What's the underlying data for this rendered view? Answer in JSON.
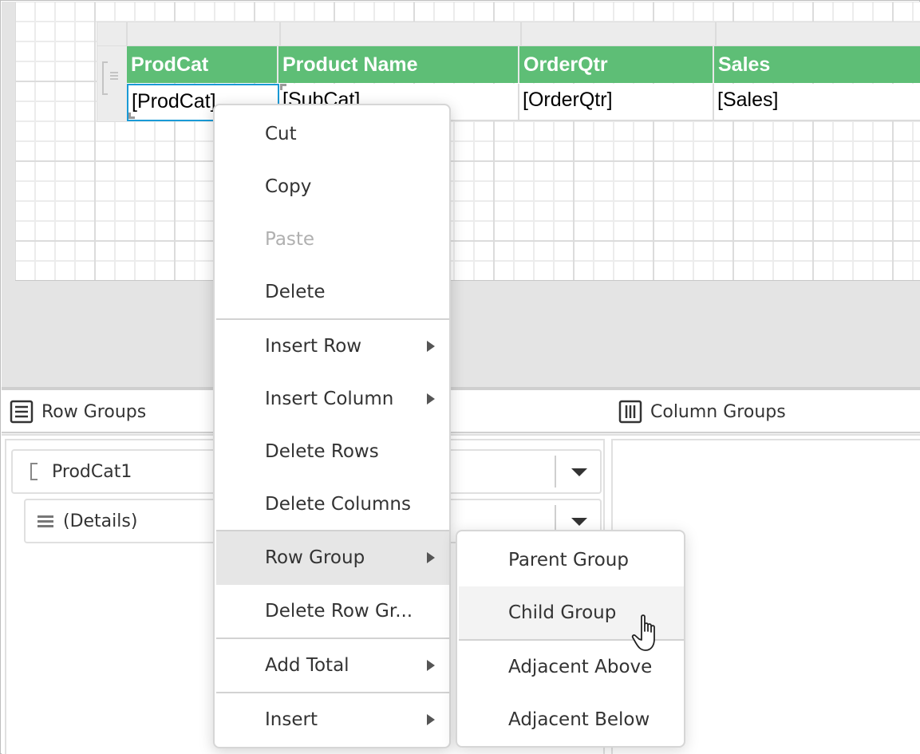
{
  "report_table": {
    "columns": [
      {
        "header": "ProdCat",
        "value": "[ProdCat]"
      },
      {
        "header": "Product Name",
        "value": "[SubCat]"
      },
      {
        "header": "OrderQtr",
        "value": "[OrderQtr]"
      },
      {
        "header": "Sales",
        "value": "[Sales]"
      }
    ],
    "header_color": "#5ebe76",
    "selected_color": "#1a9ad6"
  },
  "row_groups_panel": {
    "title": "Row Groups",
    "icon": "list-icon",
    "items": [
      {
        "label": "ProdCat1",
        "icon": "bracket-icon"
      },
      {
        "label": "(Details)",
        "icon": "details-lines-icon"
      }
    ]
  },
  "column_groups_panel": {
    "title": "Column Groups",
    "icon": "columns-icon"
  },
  "context_menu": {
    "items": [
      {
        "label": "Cut",
        "enabled": true,
        "submenu": false
      },
      {
        "label": "Copy",
        "enabled": true,
        "submenu": false
      },
      {
        "label": "Paste",
        "enabled": false,
        "submenu": false
      },
      {
        "label": "Delete",
        "enabled": true,
        "submenu": false
      },
      {
        "label": "Insert Row",
        "enabled": true,
        "submenu": true
      },
      {
        "label": "Insert Column",
        "enabled": true,
        "submenu": true
      },
      {
        "label": "Delete Rows",
        "enabled": true,
        "submenu": false
      },
      {
        "label": "Delete Columns",
        "enabled": true,
        "submenu": false
      },
      {
        "label": "Row Group",
        "enabled": true,
        "submenu": true,
        "highlighted": true
      },
      {
        "label": "Delete Row Gr...",
        "enabled": true,
        "submenu": false
      },
      {
        "label": "Add Total",
        "enabled": true,
        "submenu": true
      },
      {
        "label": "Insert",
        "enabled": true,
        "submenu": true
      }
    ]
  },
  "row_group_submenu": {
    "items": [
      {
        "label": "Parent Group"
      },
      {
        "label": "Child Group",
        "hovered": true
      },
      {
        "label": "Adjacent Above"
      },
      {
        "label": "Adjacent Below"
      }
    ]
  }
}
